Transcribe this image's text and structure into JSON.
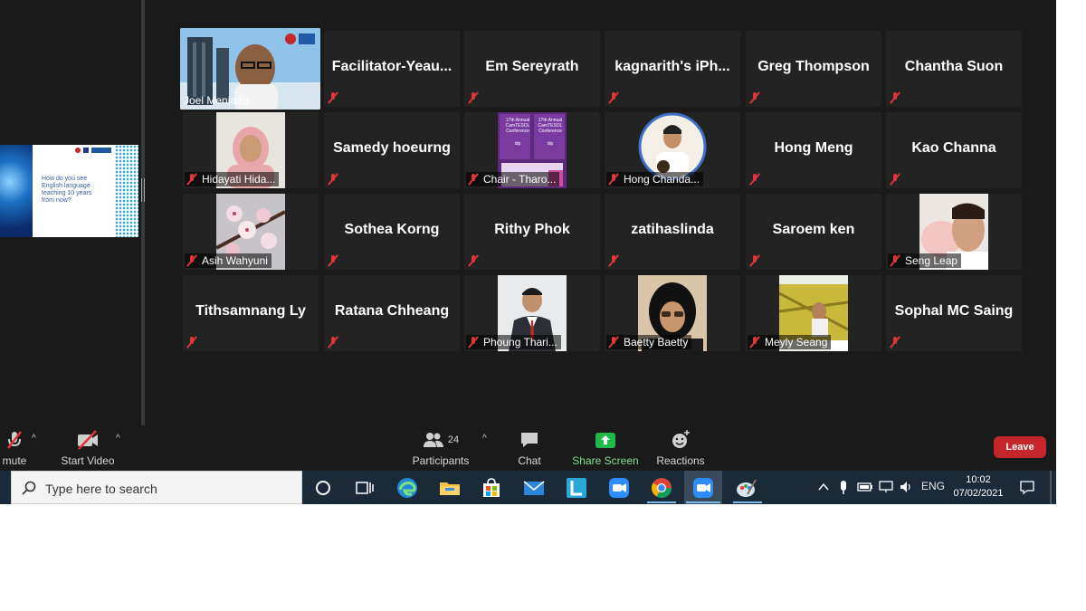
{
  "share_screen": {
    "question": "How do you see English language teaching 10 years from now?"
  },
  "gallery": {
    "row1": [
      {
        "name": "Joel Meniado",
        "has_video": true,
        "active": true
      },
      {
        "name": "Facilitator-Yeau...",
        "has_video": false
      },
      {
        "name": "Em Sereyrath",
        "has_video": false
      },
      {
        "name": "kagnarith's iPh...",
        "has_video": false
      },
      {
        "name": "Greg Thompson",
        "has_video": false
      },
      {
        "name": "Chantha Suon",
        "has_video": false
      }
    ],
    "row2": [
      {
        "name": "Hidayati Hida...",
        "has_video": true
      },
      {
        "name": "Samedy hoeurng",
        "has_video": false
      },
      {
        "name": "Chair - Tharo...",
        "has_video": true
      },
      {
        "name": "Hong Chanda...",
        "has_video": true
      },
      {
        "name": "Hong Meng",
        "has_video": false
      },
      {
        "name": "Kao Channa",
        "has_video": false
      }
    ],
    "row3": [
      {
        "name": "Asih Wahyuni",
        "has_video": true
      },
      {
        "name": "Sothea Korng",
        "has_video": false
      },
      {
        "name": "Rithy Phok",
        "has_video": false
      },
      {
        "name": "zatihaslinda",
        "has_video": false
      },
      {
        "name": "Saroem ken",
        "has_video": false
      },
      {
        "name": "Seng Leap",
        "has_video": true
      }
    ],
    "row4": [
      {
        "name": "Tithsamnang Ly",
        "has_video": false
      },
      {
        "name": "Ratana Chheang",
        "has_video": false
      },
      {
        "name": "Phoung Thari...",
        "has_video": true
      },
      {
        "name": "Baetty Baetty",
        "has_video": true
      },
      {
        "name": "Meyly Seang",
        "has_video": true
      },
      {
        "name": "Sophal MC Saing",
        "has_video": false
      }
    ]
  },
  "slide_logo": "RELC",
  "conference_poster_lines": [
    "17th Annual",
    "CamTESOL",
    "Conference"
  ],
  "poster_brand": "idp",
  "toolbar": {
    "unmute_label": "mute",
    "start_video_label": "Start Video",
    "participants_label": "Participants",
    "participants_count": "24",
    "chat_label": "Chat",
    "share_screen_label": "Share Screen",
    "reactions_label": "Reactions",
    "leave_label": "Leave"
  },
  "taskbar": {
    "search_placeholder": "Type here to search",
    "language": "ENG",
    "time": "10:02",
    "date": "07/02/2021"
  },
  "colors": {
    "window_bg": "#1a1a1a",
    "tile_bg": "#232323",
    "active_speaker": "#e8e86a",
    "share_green": "#1fb94a",
    "leave_red": "#c4262b",
    "mic_off_red": "#e0353a",
    "taskbar_bg": "#1b2a38"
  }
}
